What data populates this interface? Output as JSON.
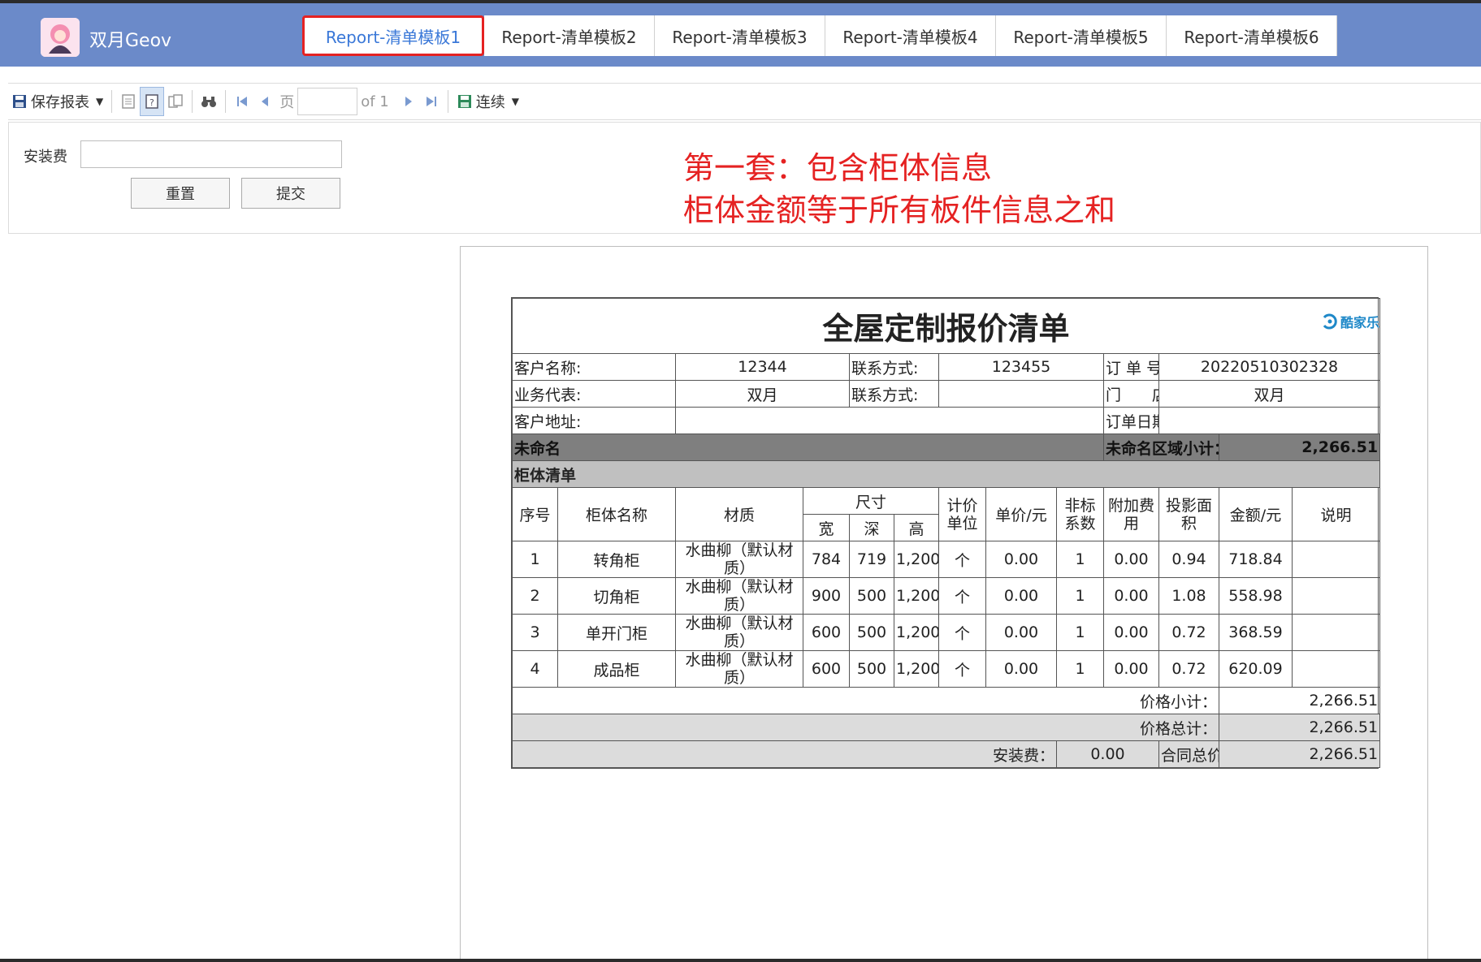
{
  "app": {
    "title": "双月Geov",
    "tabs": [
      {
        "label": "Report-清单模板1"
      },
      {
        "label": "Report-清单模板2"
      },
      {
        "label": "Report-清单模板3"
      },
      {
        "label": "Report-清单模板4"
      },
      {
        "label": "Report-清单模板5"
      },
      {
        "label": "Report-清单模板6"
      }
    ]
  },
  "toolbar": {
    "save_label": "保存报表",
    "page_label": "页",
    "page_value": "",
    "of_label": "of 1",
    "mode_label": "连续"
  },
  "params": {
    "install_label": "安装费",
    "install_value": "",
    "reset_label": "重置",
    "submit_label": "提交"
  },
  "annotation": {
    "line1": "第一套：包含柜体信息",
    "line2": "柜体金额等于所有板件信息之和"
  },
  "report": {
    "title": "全屋定制报价清单",
    "brand": "酷家乐",
    "info": {
      "customer_label": "客户名称:",
      "customer": "12344",
      "contact_label": "联系方式:",
      "contact": "123455",
      "order_no_label": "订 单 号：",
      "order_no": "20220510302328",
      "rep_label": "业务代表:",
      "rep": "双月",
      "contact2_label": "联系方式:",
      "contact2": "",
      "store_label": "门　　店:",
      "store": "双月",
      "address_label": "客户地址:",
      "address": "",
      "order_date_label": "订单日期:",
      "order_date": ""
    },
    "area": {
      "name": "未命名",
      "subtotal_label": "未命名区域小计：",
      "subtotal": "2,266.51"
    },
    "section_title": "柜体清单",
    "headers": {
      "no": "序号",
      "name": "柜体名称",
      "material": "材质",
      "size": "尺寸",
      "w": "宽",
      "d": "深",
      "h": "高",
      "unit": "计价单位",
      "price": "单价/元",
      "nonstd": "非标系数",
      "extra": "附加费用",
      "area": "投影面积",
      "amount": "金额/元",
      "note": "说明"
    },
    "rows": [
      {
        "no": "1",
        "name": "转角柜",
        "material": "水曲柳（默认材质）",
        "w": "784",
        "d": "719",
        "h": "1,200",
        "unit": "个",
        "price": "0.00",
        "nonstd": "1",
        "extra": "0.00",
        "area": "0.94",
        "amount": "718.84",
        "note": ""
      },
      {
        "no": "2",
        "name": "切角柜",
        "material": "水曲柳（默认材质）",
        "w": "900",
        "d": "500",
        "h": "1,200",
        "unit": "个",
        "price": "0.00",
        "nonstd": "1",
        "extra": "0.00",
        "area": "1.08",
        "amount": "558.98",
        "note": ""
      },
      {
        "no": "3",
        "name": "单开门柜",
        "material": "水曲柳（默认材质）",
        "w": "600",
        "d": "500",
        "h": "1,200",
        "unit": "个",
        "price": "0.00",
        "nonstd": "1",
        "extra": "0.00",
        "area": "0.72",
        "amount": "368.59",
        "note": ""
      },
      {
        "no": "4",
        "name": "成品柜",
        "material": "水曲柳（默认材质）",
        "w": "600",
        "d": "500",
        "h": "1,200",
        "unit": "个",
        "price": "0.00",
        "nonstd": "1",
        "extra": "0.00",
        "area": "0.72",
        "amount": "620.09",
        "note": ""
      }
    ],
    "subtotal_label": "价格小计：",
    "subtotal": "2,266.51",
    "total_label": "价格总计：",
    "total": "2,266.51",
    "install_label": "安装费：",
    "install": "0.00",
    "contract_label": "合同总价：",
    "contract": "2,266.51"
  },
  "colors": {
    "header_bg": "#6b8ac9",
    "active_tab": "#3a78d8",
    "highlight": "#e52222",
    "annotation": "#e52222"
  }
}
